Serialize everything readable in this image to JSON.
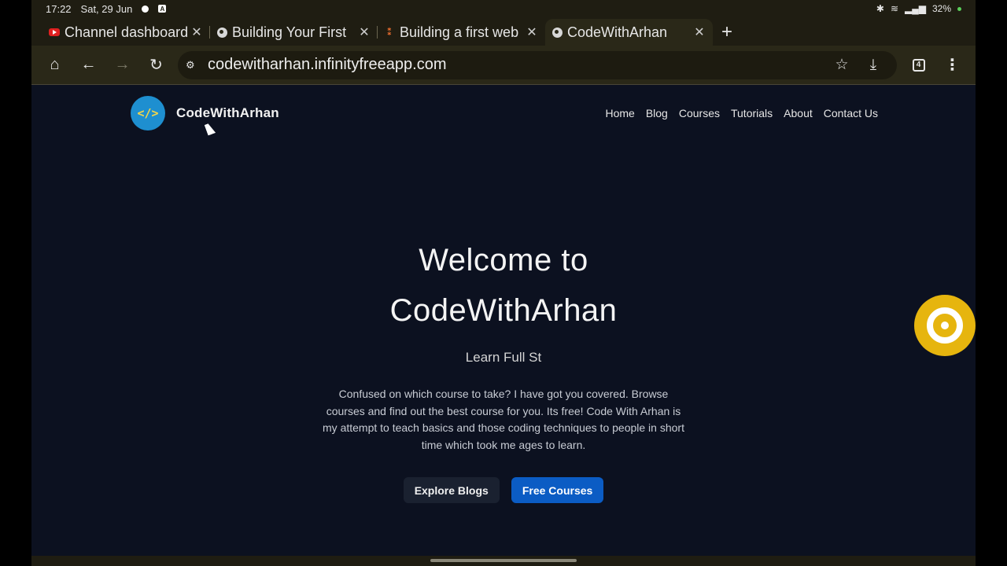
{
  "status": {
    "time": "17:22",
    "date": "Sat, 29 Jun",
    "battery": "32%"
  },
  "tabs": [
    {
      "title": "Channel dashboard",
      "favicon": "youtube-icon"
    },
    {
      "title": "Building Your First",
      "favicon": "globe-icon"
    },
    {
      "title": "Building a first web",
      "favicon": "blogger-icon"
    },
    {
      "title": "CodeWithArhan",
      "favicon": "globe-icon"
    }
  ],
  "toolbar": {
    "url": "codewitharhan.infinityfreeapp.com",
    "tab_count": "4"
  },
  "site": {
    "logo_text": "</>",
    "brand": "CodeWithArhan",
    "nav": [
      "Home",
      "Blog",
      "Courses",
      "Tutorials",
      "About",
      "Contact Us"
    ]
  },
  "hero": {
    "title_line1": "Welcome to",
    "title_line2": "CodeWithArhan",
    "subtitle": "Learn Full St",
    "description": "Confused on which course to take? I have got you covered. Browse courses and find out the best course for you. Its free! Code With Arhan is my attempt to teach basics and those coding techniques to people in short time which took me ages to learn.",
    "button_primary": "Explore Blogs",
    "button_secondary": "Free Courses"
  },
  "colors": {
    "accent": "#0b5cc4",
    "fab": "#e6b50e",
    "background": "#0c1120"
  }
}
